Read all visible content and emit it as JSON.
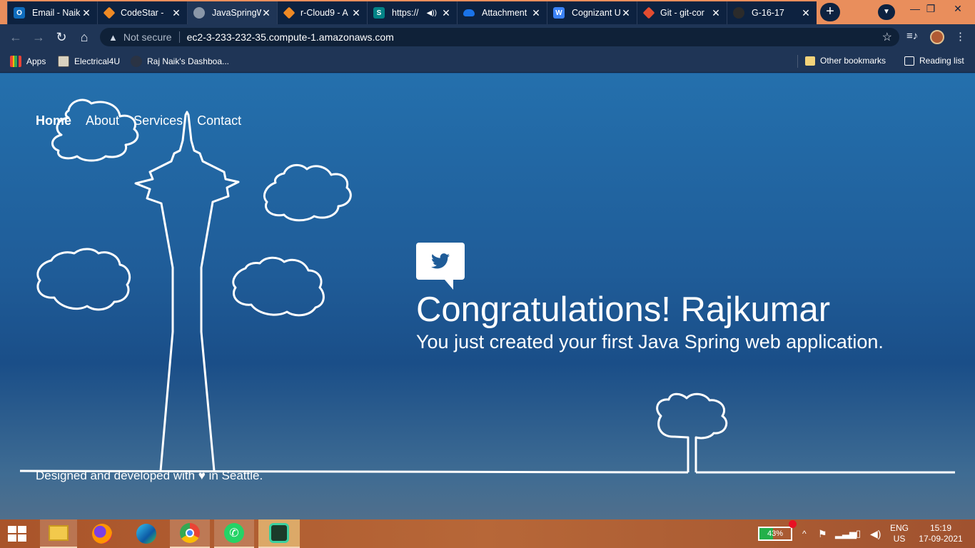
{
  "browser": {
    "tabs": [
      {
        "title": "Email - Naik",
        "icon": "outlook-icon",
        "color": "#0f6cbd",
        "glyph": "O"
      },
      {
        "title": "CodeStar - ",
        "icon": "aws-icon",
        "color": "#f08a24",
        "glyph": ""
      },
      {
        "title": "JavaSpringW",
        "icon": "globe-icon",
        "color": "#8a97a8",
        "glyph": ""
      },
      {
        "title": "r-Cloud9 - A",
        "icon": "aws-icon",
        "color": "#f08a24",
        "glyph": ""
      },
      {
        "title": "https://",
        "icon": "sharepoint-icon",
        "color": "#038387",
        "glyph": "S"
      },
      {
        "title": "Attachment",
        "icon": "onedrive-icon",
        "color": "#1a73e8",
        "glyph": ""
      },
      {
        "title": "Cognizant U",
        "icon": "webex-icon",
        "color": "#3b82f6",
        "glyph": "W"
      },
      {
        "title": "Git - git-cor",
        "icon": "git-icon",
        "color": "#e44c30",
        "glyph": ""
      },
      {
        "title": "G-16-17",
        "icon": "github-icon",
        "color": "#2b2b2b",
        "glyph": ""
      }
    ],
    "address": {
      "security_label": "Not secure",
      "url": "ec2-3-233-232-35.compute-1.amazonaws.com"
    },
    "bookmarks": [
      {
        "label": "Apps",
        "icon": "apps-grid-icon"
      },
      {
        "label": "Electrical4U",
        "icon": "electrical4u-icon"
      },
      {
        "label": "Raj Naik's Dashboa...",
        "icon": "dashboard-icon"
      }
    ],
    "other_bookmarks": "Other bookmarks",
    "reading_list": "Reading list"
  },
  "page": {
    "nav": [
      "Home",
      "About",
      "Services",
      "Contact"
    ],
    "heading": "Congratulations! Rajkumar",
    "subheading": "You just created your first Java Spring web application.",
    "footer": "Designed and developed with ♥ in Seattle."
  },
  "taskbar": {
    "battery_percent": "43%",
    "battery_level": 0.43,
    "language": "ENG",
    "region": "US",
    "time": "15:19",
    "date": "17-09-2021"
  }
}
